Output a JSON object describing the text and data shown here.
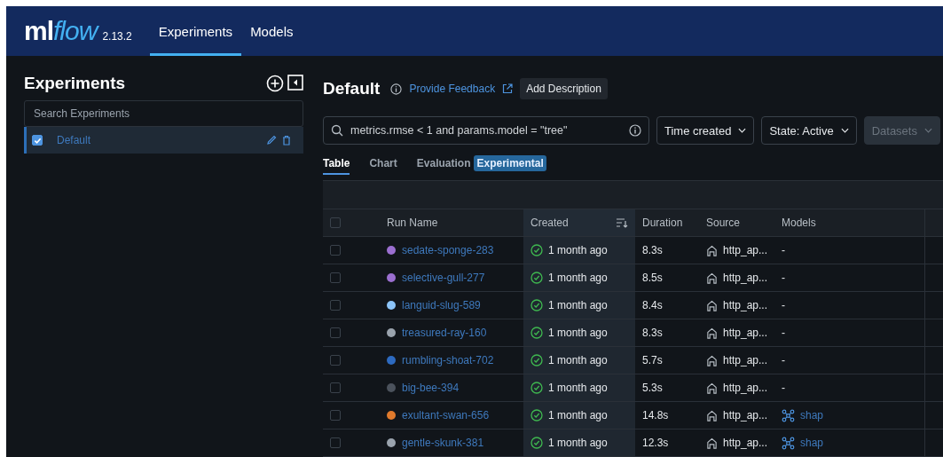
{
  "header": {
    "logo": "mlflow",
    "version": "2.13.2",
    "tabs": [
      {
        "label": "Experiments",
        "selected": true
      },
      {
        "label": "Models",
        "selected": false
      }
    ]
  },
  "sidebar": {
    "title": "Experiments",
    "search": {
      "placeholder": "Search Experiments"
    },
    "items": [
      {
        "label": "Default",
        "checked": true,
        "selected": true
      }
    ]
  },
  "experiment": {
    "title": "Default",
    "feedback_link": "Provide Feedback",
    "add_description": "Add Description"
  },
  "filters": {
    "search": {
      "value": "metrics.rmse < 1 and params.model = \"tree\""
    },
    "buttons": [
      {
        "label": "Time created",
        "disabled": false
      },
      {
        "label": "State: Active",
        "disabled": false
      },
      {
        "label": "Datasets",
        "disabled": true
      }
    ]
  },
  "view_tabs": [
    {
      "label": "Table",
      "selected": true
    },
    {
      "label": "Chart",
      "selected": false
    },
    {
      "label": "Evaluation",
      "selected": false,
      "badge": "Experimental"
    }
  ],
  "table": {
    "header_checked": false,
    "columns": [
      "Run Name",
      "Created",
      "Duration",
      "Source",
      "Models"
    ],
    "rows": [
      {
        "checked": false,
        "color": "#9b6fd0",
        "run_name": "sedate-sponge-283",
        "created": "1 month ago",
        "duration": "8.3s",
        "source": "http_ap...",
        "models": "-"
      },
      {
        "checked": false,
        "color": "#9b6fd0",
        "run_name": "selective-gull-277",
        "created": "1 month ago",
        "duration": "8.5s",
        "source": "http_ap...",
        "models": "-"
      },
      {
        "checked": false,
        "color": "#8cc4f8",
        "run_name": "languid-slug-589",
        "created": "1 month ago",
        "duration": "8.4s",
        "source": "http_ap...",
        "models": "-"
      },
      {
        "checked": false,
        "color": "#9aa3ad",
        "run_name": "treasured-ray-160",
        "created": "1 month ago",
        "duration": "8.3s",
        "source": "http_ap...",
        "models": "-"
      },
      {
        "checked": false,
        "color": "#2d6ac0",
        "run_name": "rumbling-shoat-702",
        "created": "1 month ago",
        "duration": "5.7s",
        "source": "http_ap...",
        "models": "-"
      },
      {
        "checked": false,
        "color": "#4b525c",
        "run_name": "big-bee-394",
        "created": "1 month ago",
        "duration": "5.3s",
        "source": "http_ap...",
        "models": "-"
      },
      {
        "checked": false,
        "color": "#e07a2c",
        "run_name": "exultant-swan-656",
        "created": "1 month ago",
        "duration": "14.8s",
        "source": "http_ap...",
        "models": "shap",
        "kind": "link"
      },
      {
        "checked": false,
        "color": "#9aa3ad",
        "run_name": "gentle-skunk-381",
        "created": "1 month ago",
        "duration": "12.3s",
        "source": "http_ap...",
        "models": "shap",
        "kind": "link"
      }
    ]
  }
}
